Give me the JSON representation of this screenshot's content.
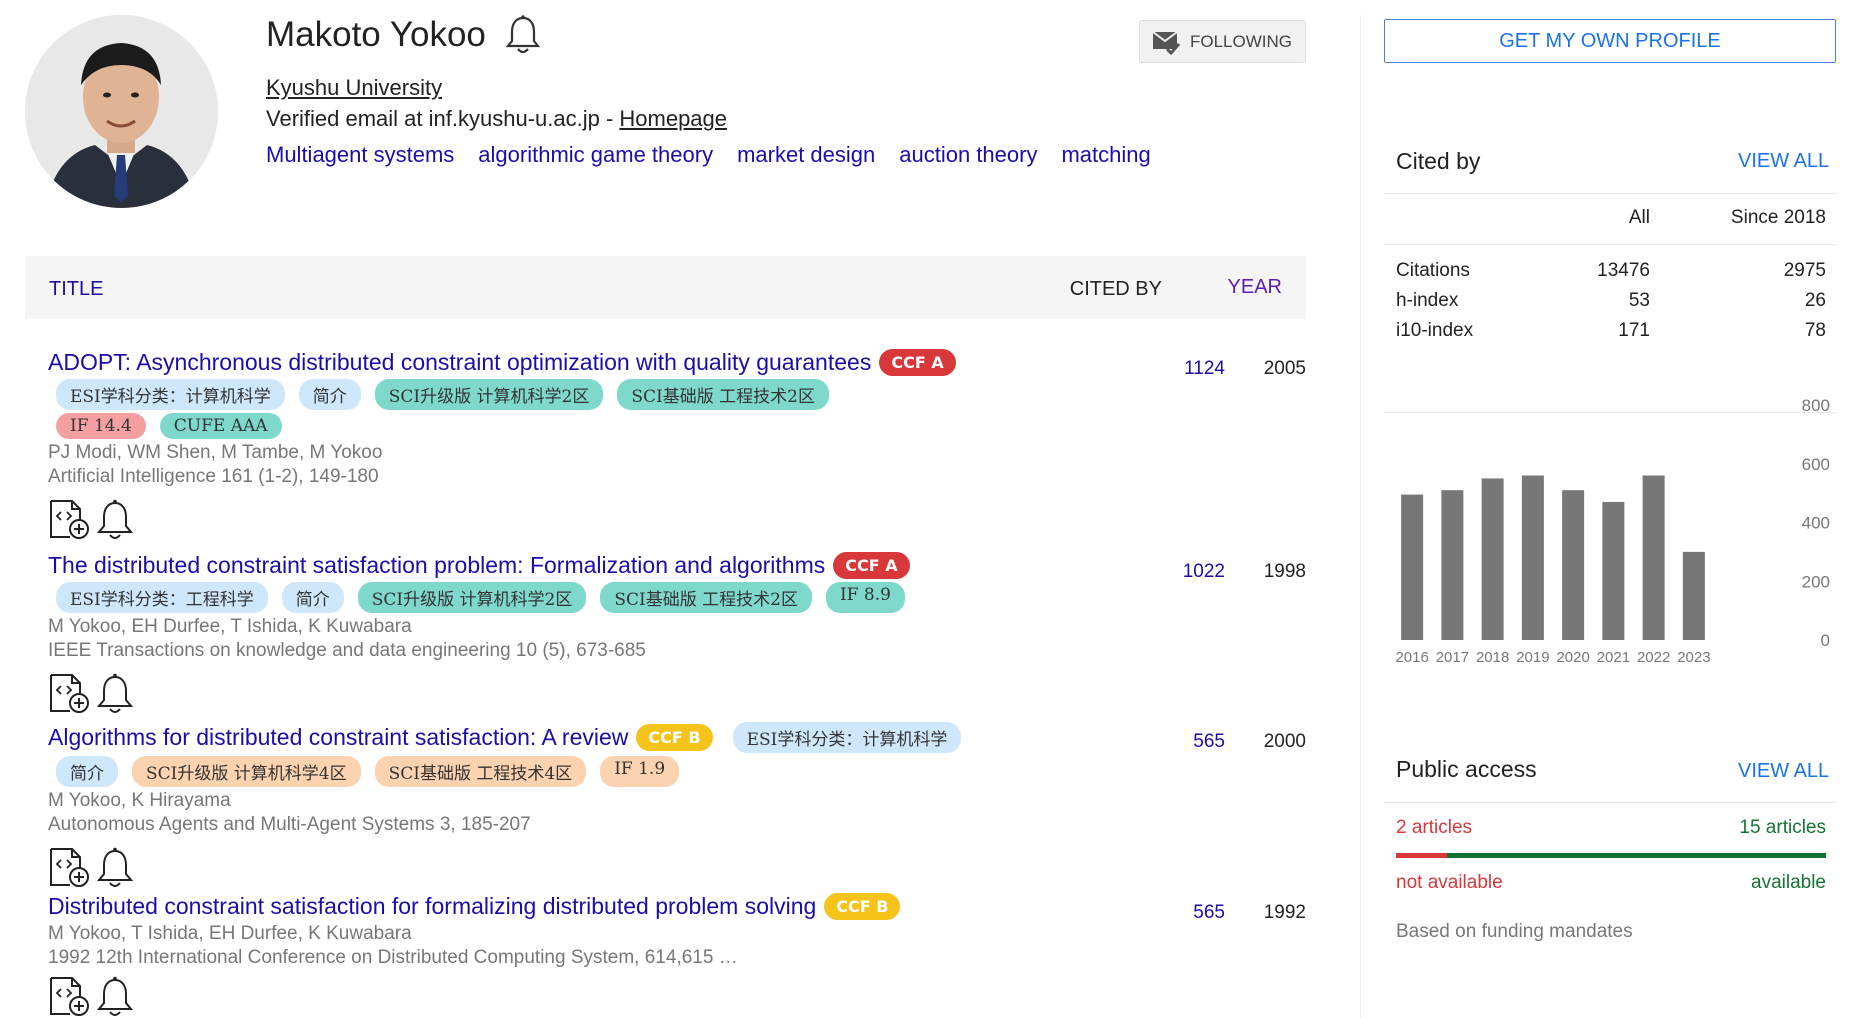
{
  "profile": {
    "name": "Makoto Yokoo",
    "affiliation": "Kyushu University",
    "email_text": "Verified email at inf.kyushu-u.ac.jp - ",
    "homepage_label": "Homepage",
    "follow_label": "FOLLOWING",
    "interests": [
      "Multiagent systems",
      "algorithmic game theory",
      "market design",
      "auction theory",
      "matching"
    ]
  },
  "table": {
    "title_header": "TITLE",
    "cited_header": "CITED BY",
    "year_header": "YEAR"
  },
  "articles": [
    {
      "title": "ADOPT: Asynchronous distributed constraint optimization with quality guarantees",
      "ccf": "CCF A",
      "tags": [
        "ESI学科分类：计算机科学",
        "简介",
        "SCI升级版 计算机科学2区",
        "SCI基础版 工程技术2区",
        "IF 14.4",
        "CUFE AAA"
      ],
      "authors": "PJ Modi, WM Shen, M Tambe, M Yokoo",
      "venue": "Artificial Intelligence 161 (1-2), 149-180",
      "cited_by": "1124",
      "year": "2005"
    },
    {
      "title": "The distributed constraint satisfaction problem: Formalization and algorithms",
      "ccf": "CCF A",
      "tags": [
        "ESI学科分类：工程科学",
        "简介",
        "SCI升级版 计算机科学2区",
        "SCI基础版 工程技术2区",
        "IF 8.9"
      ],
      "authors": "M Yokoo, EH Durfee, T Ishida, K Kuwabara",
      "venue": "IEEE Transactions on knowledge and data engineering 10 (5), 673-685",
      "cited_by": "1022",
      "year": "1998"
    },
    {
      "title": "Algorithms for distributed constraint satisfaction: A review",
      "ccf": "CCF B",
      "tags": [
        "ESI学科分类：计算机科学",
        "简介",
        "SCI升级版 计算机科学4区",
        "SCI基础版 工程技术4区",
        "IF 1.9"
      ],
      "authors": "M Yokoo, K Hirayama",
      "venue": "Autonomous Agents and Multi-Agent Systems 3, 185-207",
      "cited_by": "565",
      "year": "2000"
    },
    {
      "title": "Distributed constraint satisfaction for formalizing distributed problem solving",
      "ccf": "CCF B",
      "tags": [],
      "authors": "M Yokoo, T Ishida, EH Durfee, K Kuwabara",
      "venue": "1992 12th International Conference on Distributed Computing System, 614,615 …",
      "cited_by": "565",
      "year": "1992"
    }
  ],
  "sidebar": {
    "get_profile_label": "GET MY OWN PROFILE",
    "cited_by": {
      "title": "Cited by",
      "view_all": "VIEW ALL",
      "col_all": "All",
      "col_since": "Since 2018",
      "rows": [
        {
          "label": "Citations",
          "all": "13476",
          "since": "2975"
        },
        {
          "label": "h-index",
          "all": "53",
          "since": "26"
        },
        {
          "label": "i10-index",
          "all": "171",
          "since": "78"
        }
      ]
    },
    "public_access": {
      "title": "Public access",
      "view_all": "VIEW ALL",
      "not_available_count": "2 articles",
      "available_count": "15 articles",
      "not_available_label": "not available",
      "available_label": "available",
      "note": "Based on funding mandates",
      "not_available_fraction": 0.118
    }
  },
  "colors": {
    "link": "#1a0dab",
    "ccf_a": "#d9383a",
    "ccf_b": "#f6c31b",
    "bar": "#777777",
    "available": "#137333",
    "not_available": "#d9383a"
  },
  "chart_data": {
    "type": "bar",
    "categories": [
      "2016",
      "2017",
      "2018",
      "2019",
      "2020",
      "2021",
      "2022",
      "2023"
    ],
    "values": [
      495,
      510,
      550,
      560,
      510,
      470,
      560,
      300
    ],
    "yticks": [
      0,
      200,
      400,
      600,
      800
    ],
    "ylim": [
      0,
      800
    ],
    "grid": false
  }
}
